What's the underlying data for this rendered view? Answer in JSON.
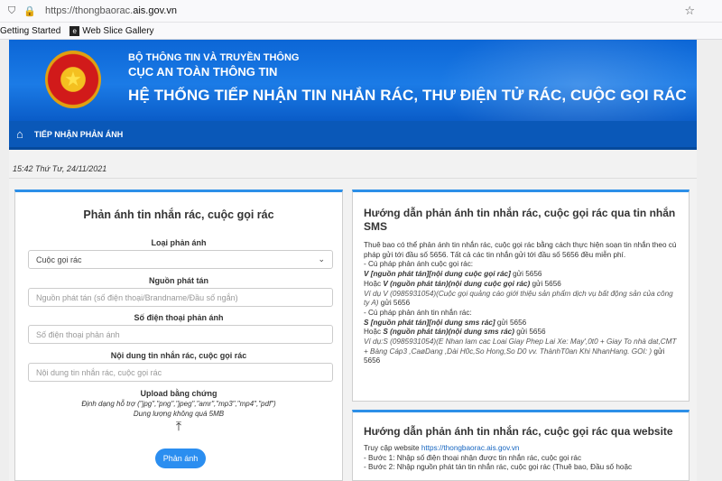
{
  "browser": {
    "url_prefix": "https://thongbaorac.",
    "url_domain": "ais.gov.vn",
    "bookmarks": [
      "Getting Started",
      "Web Slice Gallery"
    ]
  },
  "header": {
    "ministry": "BỘ THÔNG TIN VÀ TRUYỀN THÔNG",
    "agency": "CỤC AN TOÀN THÔNG TIN",
    "system_title": "HỆ THỐNG TIẾP NHẬN TIN NHẮN RÁC, THƯ ĐIỆN TỬ RÁC, CUỘC GỌI RÁC"
  },
  "nav": {
    "item": "TIẾP NHẬN PHẢN ÁNH"
  },
  "datetime": "15:42 Thứ Tư, 24/11/2021",
  "form": {
    "title": "Phản ánh tin nhắn rác, cuộc gọi rác",
    "type_label": "Loại phản ánh",
    "type_value": "Cuộc gọi rác",
    "source_label": "Nguồn phát tán",
    "source_placeholder": "Nguồn phát tán (số điện thoại/Brandname/Đầu số ngắn)",
    "phone_label": "Số điện thoại phản ánh",
    "phone_placeholder": "Số điện thoại phản ánh",
    "content_label": "Nội dung tin nhắn rác, cuộc gọi rác",
    "content_placeholder": "Nội dung tin nhắn rác, cuộc gọi rác",
    "upload_label": "Upload bằng chứng",
    "upload_formats": "Định dạng hỗ trợ (\"jpg\",\"png\",\"jpeg\",\"amr\",\"mp3\",\"mp4\",\"pdf\")",
    "upload_limit": "Dung lượng không quá 5MB",
    "submit_label": "Phản ánh"
  },
  "sms_guide": {
    "title": "Hướng dẫn phản ánh tin nhắn rác, cuộc gọi rác qua tin nhắn SMS",
    "intro": "Thuê bao có thể phản ánh tin nhắn rác, cuộc gọi rác bằng cách thực hiện soạn tin nhắn theo cú pháp gửi tới đầu số 5656. Tất cả các tin nhắn gửi tới đầu số 5656 đều miễn phí.",
    "call_syntax_heading": "- Cú pháp phản ánh cuộc gọi rác:",
    "call_syntax_1": "V [nguồn phát tán][nội dung cuộc gọi rác]",
    "call_syntax_1_suffix": " gửi 5656",
    "call_syntax_2_prefix": "Hoặc ",
    "call_syntax_2": "V (nguồn phát tán)(nội dung cuộc gọi rác)",
    "call_syntax_2_suffix": " gửi 5656",
    "call_example": "Ví dụ V (0985931054)(Cuộc gọi quảng cáo giới thiệu sản phẩm dịch vụ bất động sản của công ty A)",
    "call_example_suffix": " gửi 5656",
    "sms_syntax_heading": "- Cú pháp phản ánh tin nhắn rác:",
    "sms_syntax_1": "S [nguồn phát tán][nội dung sms rác]",
    "sms_syntax_1_suffix": " gửi 5656",
    "sms_syntax_2_prefix": "Hoặc ",
    "sms_syntax_2": "S (nguồn phát tán)(nội dung sms rác)",
    "sms_syntax_2_suffix": " gửi 5656",
    "sms_example": "Ví dụ:S (0985931054)(E Nhan lam cac Loai Giay Phep Lai Xe: May',0t0 + Giay To nhà dat,CMT + Bàng Cáp3 ,CaøDang ,Dài H0c,So Hong,So D0 vv. ThànhT0an Khi NhanHang. GOI: )",
    "sms_example_suffix": " gửi 5656"
  },
  "web_guide": {
    "title": "Hướng dẫn phản ánh tin nhắn rác, cuộc gọi rác qua website",
    "access_prefix": "Truy cập website ",
    "access_link": "https://thongbaorac.ais.gov.vn",
    "step1": "- Bước 1: Nhập số điện thoại nhận được tin nhắn rác, cuộc gọi rác",
    "step2": "- Bước 2: Nhập nguồn phát tán tin nhắn rác, cuộc gọi rác (Thuê bao, Đầu số hoặc"
  },
  "colors": {
    "banner": "#1b7be6",
    "nav": "#0a58b8",
    "accent": "#2b8ef0"
  }
}
